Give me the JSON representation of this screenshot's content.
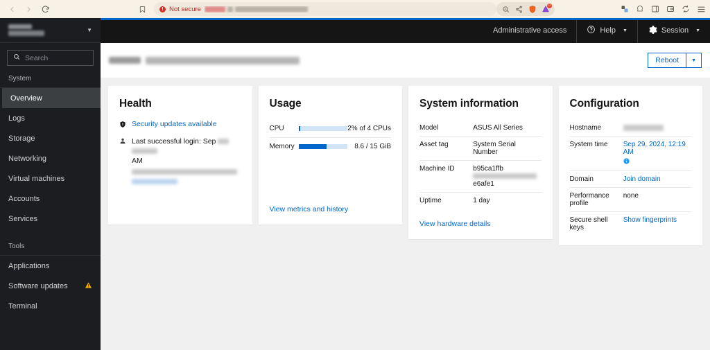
{
  "browser": {
    "back_icon": "back-arrow-icon",
    "forward_icon": "forward-arrow-icon",
    "reload_icon": "reload-icon",
    "bookmark_icon": "bookmark-icon",
    "security_label": "Not secure",
    "url_value": "",
    "url_redacted": true,
    "omni_icons": [
      "zoom-out-icon",
      "share-icon",
      "brave-shield-icon",
      "brave-rewards-icon"
    ],
    "rewards_badge": "0",
    "right_icons": [
      "extensions-icon",
      "brave-leo-icon",
      "sidebar-panel-icon",
      "wallet-icon",
      "sync-icon",
      "menu-icon"
    ]
  },
  "topnav": {
    "admin_access": "Administrative access",
    "help": "Help",
    "session": "Session",
    "help_icon": "help-circle-icon",
    "session_icon": "gear-icon",
    "caret_icon": "chevron-down-icon"
  },
  "sidebar": {
    "host_redacted": true,
    "host_line1": "",
    "host_line2": "",
    "caret_icon": "chevron-down-icon",
    "search": {
      "placeholder": "Search",
      "value": "",
      "icon": "search-icon"
    },
    "groups": [
      {
        "label": "System",
        "items": [
          {
            "label": "Overview",
            "active": true,
            "badge": ""
          },
          {
            "label": "Logs",
            "active": false,
            "badge": ""
          },
          {
            "label": "Storage",
            "active": false,
            "badge": ""
          },
          {
            "label": "Networking",
            "active": false,
            "badge": ""
          },
          {
            "label": "Virtual machines",
            "active": false,
            "badge": ""
          },
          {
            "label": "Accounts",
            "active": false,
            "badge": ""
          },
          {
            "label": "Services",
            "active": false,
            "badge": ""
          }
        ]
      },
      {
        "label": "Tools",
        "items": [
          {
            "label": "Applications",
            "active": false,
            "badge": ""
          },
          {
            "label": "Software updates",
            "active": false,
            "badge": "warning-triangle-icon"
          },
          {
            "label": "Terminal",
            "active": false,
            "badge": ""
          }
        ]
      }
    ]
  },
  "page": {
    "title_redacted": true,
    "title": "",
    "reboot_label": "Reboot",
    "reboot_caret_icon": "caret-down-icon"
  },
  "cards": {
    "health": {
      "title": "Health",
      "security_updates_link": "Security updates available",
      "security_icon": "shield-icon",
      "login_icon": "user-icon",
      "last_login_prefix": "Last successful login: Sep",
      "last_login_suffix": "AM",
      "last_login_redacted": true,
      "detail_redacted_line": "",
      "detail_redacted_link": ""
    },
    "usage": {
      "title": "Usage",
      "rows": [
        {
          "label": "CPU",
          "percent": 2,
          "value": "2% of 4 CPUs"
        },
        {
          "label": "Memory",
          "percent": 57,
          "value": "8.6 / 15 GiB"
        }
      ],
      "footer_link": "View metrics and history"
    },
    "system_information": {
      "title": "System information",
      "rows": [
        {
          "key": "Model",
          "value": "ASUS All Series",
          "redacted": false
        },
        {
          "key": "Asset tag",
          "value": "System Serial Number",
          "redacted": false
        },
        {
          "key": "Machine ID",
          "value": "b95ca1ffb",
          "value2": "e6afe1",
          "redacted": true
        },
        {
          "key": "Uptime",
          "value": "1 day",
          "redacted": false
        }
      ],
      "footer_link": "View hardware details"
    },
    "configuration": {
      "title": "Configuration",
      "rows": [
        {
          "key": "Hostname",
          "value": "",
          "type": "redacted"
        },
        {
          "key": "System time",
          "value": "Sep 29, 2024, 12:19 AM",
          "type": "link",
          "info_icon": "info-circle-icon"
        },
        {
          "key": "Domain",
          "value": "Join domain",
          "type": "link"
        },
        {
          "key": "Performance profile",
          "value": "none",
          "type": "muted"
        },
        {
          "key": "Secure shell keys",
          "value": "Show fingerprints",
          "type": "link"
        }
      ]
    }
  },
  "colors": {
    "accent": "#0066cc",
    "sidebar_bg": "#1b1d21",
    "topnav_bg": "#151515",
    "warning": "#f0ab00",
    "danger": "#d93025"
  }
}
